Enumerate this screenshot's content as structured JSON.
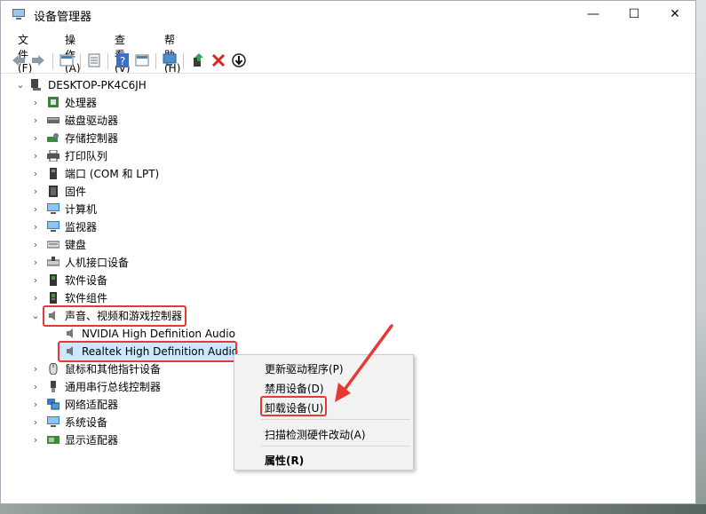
{
  "window": {
    "title": "设备管理器"
  },
  "window_controls": {
    "minimize": "—",
    "maximize": "☐",
    "close": "✕"
  },
  "menubar": [
    {
      "label": "文件(F)"
    },
    {
      "label": "操作(A)"
    },
    {
      "label": "查看(V)"
    },
    {
      "label": "帮助(H)"
    }
  ],
  "toolbar": {
    "buttons": [
      "back-icon",
      "forward-icon",
      "properties-icon",
      "device-list-icon",
      "help-icon",
      "view-icon",
      "monitor-icon",
      "update-driver-icon",
      "uninstall-icon",
      "enable-icon"
    ]
  },
  "tree": {
    "root": "DESKTOP-PK4C6JH",
    "categories": [
      {
        "label": "处理器",
        "icon": "cpu-icon"
      },
      {
        "label": "磁盘驱动器",
        "icon": "disk-icon"
      },
      {
        "label": "存储控制器",
        "icon": "storage-icon"
      },
      {
        "label": "打印队列",
        "icon": "printer-icon"
      },
      {
        "label": "端口 (COM 和 LPT)",
        "icon": "port-icon"
      },
      {
        "label": "固件",
        "icon": "firmware-icon"
      },
      {
        "label": "计算机",
        "icon": "computer-icon"
      },
      {
        "label": "监视器",
        "icon": "monitor-icon"
      },
      {
        "label": "键盘",
        "icon": "keyboard-icon"
      },
      {
        "label": "人机接口设备",
        "icon": "hid-icon"
      },
      {
        "label": "软件设备",
        "icon": "software-device-icon"
      },
      {
        "label": "软件组件",
        "icon": "software-component-icon"
      },
      {
        "label": "声音、视频和游戏控制器",
        "icon": "speaker-icon",
        "expanded": true
      },
      {
        "label": "NVIDIA High Definition Audio",
        "icon": "speaker-icon",
        "child": true
      },
      {
        "label": "Realtek High Definition Audio",
        "icon": "speaker-icon",
        "child": true,
        "selected": true
      },
      {
        "label": "鼠标和其他指针设备",
        "icon": "mouse-icon"
      },
      {
        "label": "通用串行总线控制器",
        "icon": "usb-icon"
      },
      {
        "label": "网络适配器",
        "icon": "network-icon"
      },
      {
        "label": "系统设备",
        "icon": "system-icon"
      },
      {
        "label": "显示适配器",
        "icon": "display-adapter-icon"
      }
    ]
  },
  "context_menu": {
    "update_driver": "更新驱动程序(P)",
    "disable": "禁用设备(D)",
    "uninstall": "卸载设备(U)",
    "scan": "扫描检测硬件改动(A)",
    "properties": "属性(R)"
  },
  "colors": {
    "highlight": "#e53935",
    "selection": "#cce8ff"
  }
}
